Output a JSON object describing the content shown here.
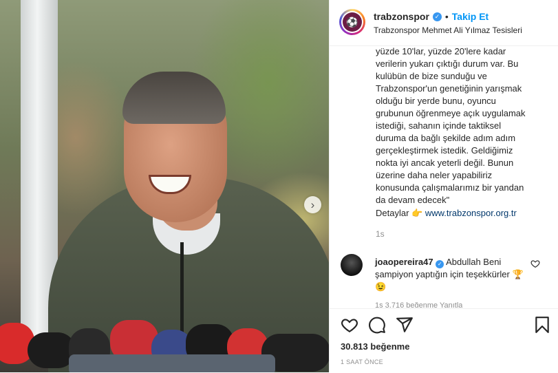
{
  "post": {
    "username": "trabzonspor",
    "follow_label": "Takip Et",
    "location": "Trabzonspor Mehmet Ali Yılmaz Tesisleri",
    "caption_lines": [
      "yüzde 10'lar, yüzde 20'lere kadar",
      "verilerin yukarı çıktığı durum var. Bu",
      "kulübün de bize sunduğu ve",
      "Trabzonspor'un genetiğinin yarışmak",
      "olduğu bir yerde bunu, oyuncu",
      "grubunun öğrenmeye açık uygulamak",
      "istediği, sahanın içinde taktiksel",
      "duruma da bağlı şekilde adım adım",
      "gerçekleştirmek istedik. Geldiğimiz",
      "nokta iyi ancak yeterli değil. Bunun",
      "üzerine daha neler yapabiliriz",
      "konusunda çalışmalarımız bir yandan",
      "da devam edecek\""
    ],
    "details_label": "Detaylar",
    "details_emoji": "👉",
    "details_link": "www.trabzonspor.org.tr",
    "caption_time": "1s",
    "likes": "30.813 beğenme",
    "post_time": "1 SAAT ÖNCE"
  },
  "comment": {
    "username": "joaopereira47",
    "text_part1": "Abdullah Beni",
    "text_part2": "şampiyon yaptığın için teşekkürler",
    "emojis": "🏆😉",
    "meta": "1s  3.716 beğenme  Yanıtla"
  },
  "icons": {
    "verified": "verified-badge-icon",
    "heart": "heart-icon",
    "comment": "comment-icon",
    "share": "share-icon",
    "save": "bookmark-icon",
    "next": "chevron-right-icon"
  },
  "colors": {
    "accent": "#0095f6",
    "verified": "#3897f0",
    "text": "#262626",
    "muted": "#8e8e8e",
    "club_maroon": "#6c1d45",
    "club_blue": "#5ea8e0"
  }
}
